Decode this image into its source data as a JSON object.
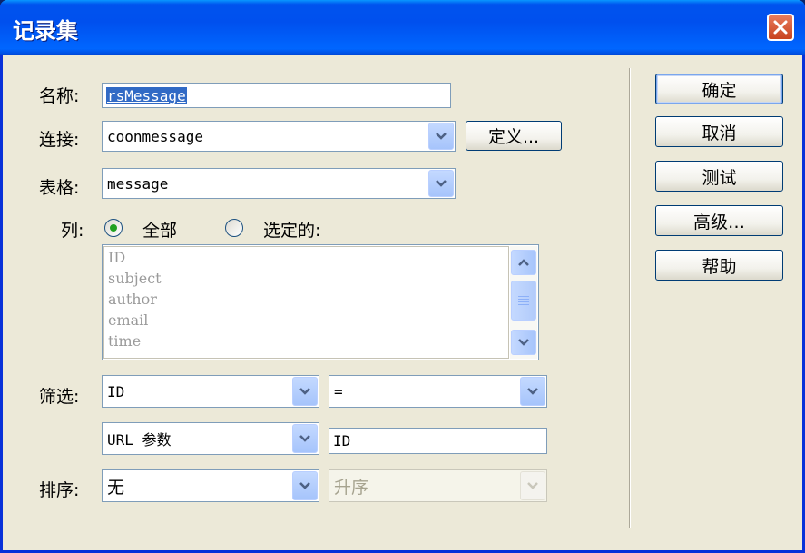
{
  "window": {
    "title": "记录集"
  },
  "form": {
    "name_label": "名称:",
    "name_value": "rsMessage",
    "connection_label": "连接:",
    "connection_value": "coonmessage",
    "define_button": "定义...",
    "table_label": "表格:",
    "table_value": "message",
    "columns_label": "列:",
    "radio_all": "全部",
    "radio_selected": "选定的:",
    "columns_list": [
      "ID",
      "subject",
      "author",
      "email",
      "time"
    ],
    "filter_label": "筛选:",
    "filter_column": "ID",
    "filter_operator": "=",
    "filter_source": "URL 参数",
    "filter_value": "ID",
    "sort_label": "排序:",
    "sort_column": "无",
    "sort_order": "升序"
  },
  "buttons": {
    "ok": "确定",
    "cancel": "取消",
    "test": "测试",
    "advanced": "高级…",
    "help": "帮助"
  }
}
